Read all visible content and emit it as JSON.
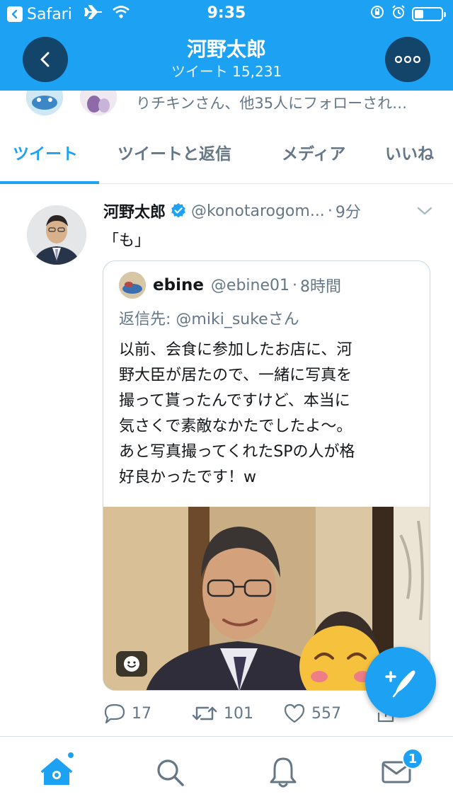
{
  "status_bar": {
    "app_back_label": "Safari",
    "time": "9:35"
  },
  "header": {
    "name": "河野太郎",
    "tweet_count": "ツイート 15,231"
  },
  "followed_by": "りチキンさん、他35人にフォローされ…",
  "tabs": [
    {
      "label": "ツイート",
      "active": true
    },
    {
      "label": "ツイートと返信",
      "active": false
    },
    {
      "label": "メディア",
      "active": false
    },
    {
      "label": "いいね",
      "active": false
    }
  ],
  "tweet": {
    "author_name": "河野太郎",
    "handle": "@konotarogom...",
    "separator": "·",
    "time": "9分",
    "text": "「も」",
    "quote": {
      "author_name": "ebine",
      "handle": "@ebine01",
      "separator": "·",
      "time": "8時間",
      "reply_prefix": "返信先:",
      "reply_mention": "@miki_sukeさん",
      "body_lines": [
        "以前、会食に参加したお店に、河",
        "野大臣が居たので、一緒に写真を",
        "撮って貰ったんですけど、本当に",
        "気さくで素敵なかたでしたよ〜。",
        "あと写真撮ってくれたSPの人が格",
        "好良かったです！w"
      ]
    },
    "actions": {
      "replies": "17",
      "retweets": "101",
      "likes": "557"
    }
  },
  "bottom_nav": {
    "messages_badge": "1"
  },
  "colors": {
    "brand_blue": "#1da1f2",
    "dark_button": "#13456b",
    "secondary_text": "#657786"
  }
}
